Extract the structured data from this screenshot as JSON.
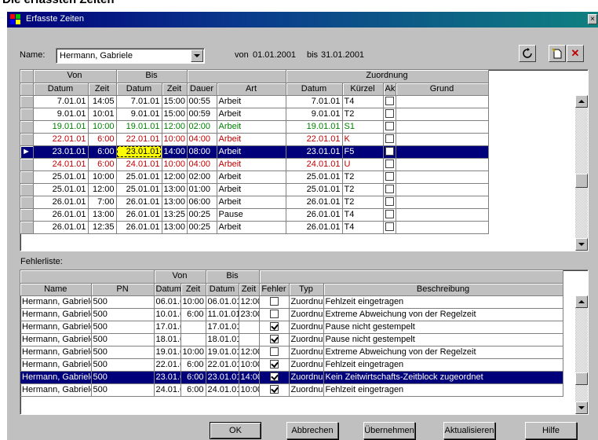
{
  "page_heading": "Die erfassten Zeiten",
  "window": {
    "title": "Erfasste Zeiten",
    "close": "×"
  },
  "filter": {
    "name_label": "Name:",
    "name_value": "Hermann, Gabriele",
    "von_label": "von",
    "von_value": "01.01.2001",
    "bis_label": "bis",
    "bis_value": "31.01.2001"
  },
  "toolbar": {
    "refresh_icon": "refresh-icon",
    "new_icon": "new-icon",
    "delete_icon": "delete-icon"
  },
  "times": {
    "group_headers": {
      "von": "Von",
      "bis": "Bis",
      "zuordnung": "Zuordnung"
    },
    "columns": [
      "Datum",
      "Zeit",
      "Datum",
      "Zeit",
      "Dauer",
      "Art",
      "Datum",
      "Kürzel",
      "Akt",
      "Grund"
    ],
    "rows": [
      {
        "style": "normal",
        "cells": [
          "7.01.01",
          "14:05",
          "7.01.01",
          "15:00",
          "00:55",
          "Arbeit",
          "7.01.01",
          "T4",
          "",
          ""
        ],
        "akt": false
      },
      {
        "style": "normal",
        "cells": [
          "9.01.01",
          "10:01",
          "9.01.01",
          "15:00",
          "00:59",
          "Arbeit",
          "9.01.01",
          "T2",
          "",
          ""
        ],
        "akt": false
      },
      {
        "style": "green",
        "cells": [
          "19.01.01",
          "10:00",
          "19.01.01",
          "12:00",
          "02:00",
          "Arbeit",
          "19.01.01",
          "S1",
          "",
          ""
        ],
        "akt": false
      },
      {
        "style": "red",
        "cells": [
          "22.01.01",
          "6:00",
          "22.01.01",
          "10:00",
          "04:00",
          "Arbeit",
          "22.01.01",
          "K",
          "",
          ""
        ],
        "akt": false
      },
      {
        "style": "sel",
        "cells": [
          "23.01.01",
          "6:00",
          "23.01.01",
          "14:00",
          "08:00",
          "Arbeit",
          "23.01.01",
          "F5",
          "",
          ""
        ],
        "akt": false
      },
      {
        "style": "red",
        "cells": [
          "24.01.01",
          "6:00",
          "24.01.01",
          "10:00",
          "04:00",
          "Arbeit",
          "24.01.01",
          "U",
          "",
          ""
        ],
        "akt": false
      },
      {
        "style": "normal",
        "cells": [
          "25.01.01",
          "10:00",
          "25.01.01",
          "12:00",
          "02:00",
          "Arbeit",
          "25.01.01",
          "T2",
          "",
          ""
        ],
        "akt": false
      },
      {
        "style": "normal",
        "cells": [
          "25.01.01",
          "12:00",
          "25.01.01",
          "13:00",
          "01:00",
          "Arbeit",
          "25.01.01",
          "T2",
          "",
          ""
        ],
        "akt": false
      },
      {
        "style": "normal",
        "cells": [
          "26.01.01",
          "7:00",
          "26.01.01",
          "13:00",
          "06:00",
          "Arbeit",
          "26.01.01",
          "T2",
          "",
          ""
        ],
        "akt": false
      },
      {
        "style": "normal",
        "cells": [
          "26.01.01",
          "13:00",
          "26.01.01",
          "13:25",
          "00:25",
          "Pause",
          "26.01.01",
          "T4",
          "",
          ""
        ],
        "akt": false
      },
      {
        "style": "normal",
        "cells": [
          "26.01.01",
          "12:35",
          "26.01.01",
          "13:00",
          "00:25",
          "Arbeit",
          "26.01.01",
          "T4",
          "",
          ""
        ],
        "akt": false
      }
    ]
  },
  "errors": {
    "label": "Fehlerliste:",
    "group_headers": {
      "von": "Von",
      "bis": "Bis"
    },
    "columns": [
      "Name",
      "PN",
      "Datum",
      "Zeit",
      "Datum",
      "Zeit",
      "Fehler",
      "Typ",
      "Beschreibung"
    ],
    "rows": [
      {
        "style": "normal",
        "cells": [
          "Hermann, Gabriele",
          "500",
          "06.01.01",
          "10:00",
          "06.01.01",
          "12:00",
          "",
          "Zuordnung",
          "Fehlzeit eingetragen"
        ],
        "checked": false
      },
      {
        "style": "normal",
        "cells": [
          "Hermann, Gabriele",
          "500",
          "10.01.01",
          "6:00",
          "11.01.01",
          "23:00",
          "",
          "Zuordnung",
          "Extreme Abweichung von der Regelzeit"
        ],
        "checked": false
      },
      {
        "style": "normal",
        "cells": [
          "Hermann, Gabriele",
          "500",
          "17.01.01",
          "",
          "17.01.01",
          "",
          "",
          "Zuordnung",
          "Pause nicht gestempelt"
        ],
        "checked": true
      },
      {
        "style": "normal",
        "cells": [
          "Hermann, Gabriele",
          "500",
          "18.01.01",
          "",
          "18.01.01",
          "",
          "",
          "Zuordnung",
          "Pause nicht gestempelt"
        ],
        "checked": true
      },
      {
        "style": "normal",
        "cells": [
          "Hermann, Gabriele",
          "500",
          "19.01.01",
          "10:00",
          "19.01.01",
          "12:00",
          "",
          "Zuordnung",
          "Extreme Abweichung von der Regelzeit"
        ],
        "checked": false
      },
      {
        "style": "normal",
        "cells": [
          "Hermann, Gabriele",
          "500",
          "22.01.01",
          "6:00",
          "22.01.01",
          "10:00",
          "",
          "Zuordnung",
          "Fehlzeit eingetragen"
        ],
        "checked": true
      },
      {
        "style": "sel",
        "cells": [
          "Hermann, Gabriele",
          "500",
          "23.01.01",
          "6:00",
          "23.01.01",
          "14:00",
          "",
          "Zuordnung",
          "Kein Zeitwirtschafts-Zeitblock zugeordnet"
        ],
        "checked": true
      },
      {
        "style": "normal",
        "cells": [
          "Hermann, Gabriele",
          "500",
          "24.01.01",
          "6:00",
          "24.01.01",
          "10:00",
          "",
          "Zuordnung",
          "Fehlzeit eingetragen"
        ],
        "checked": true
      }
    ]
  },
  "buttons": {
    "ok": "OK",
    "cancel": "Abbrechen",
    "apply": "Übernehmen",
    "refresh": "Aktualisieren",
    "help": "Hilfe"
  }
}
